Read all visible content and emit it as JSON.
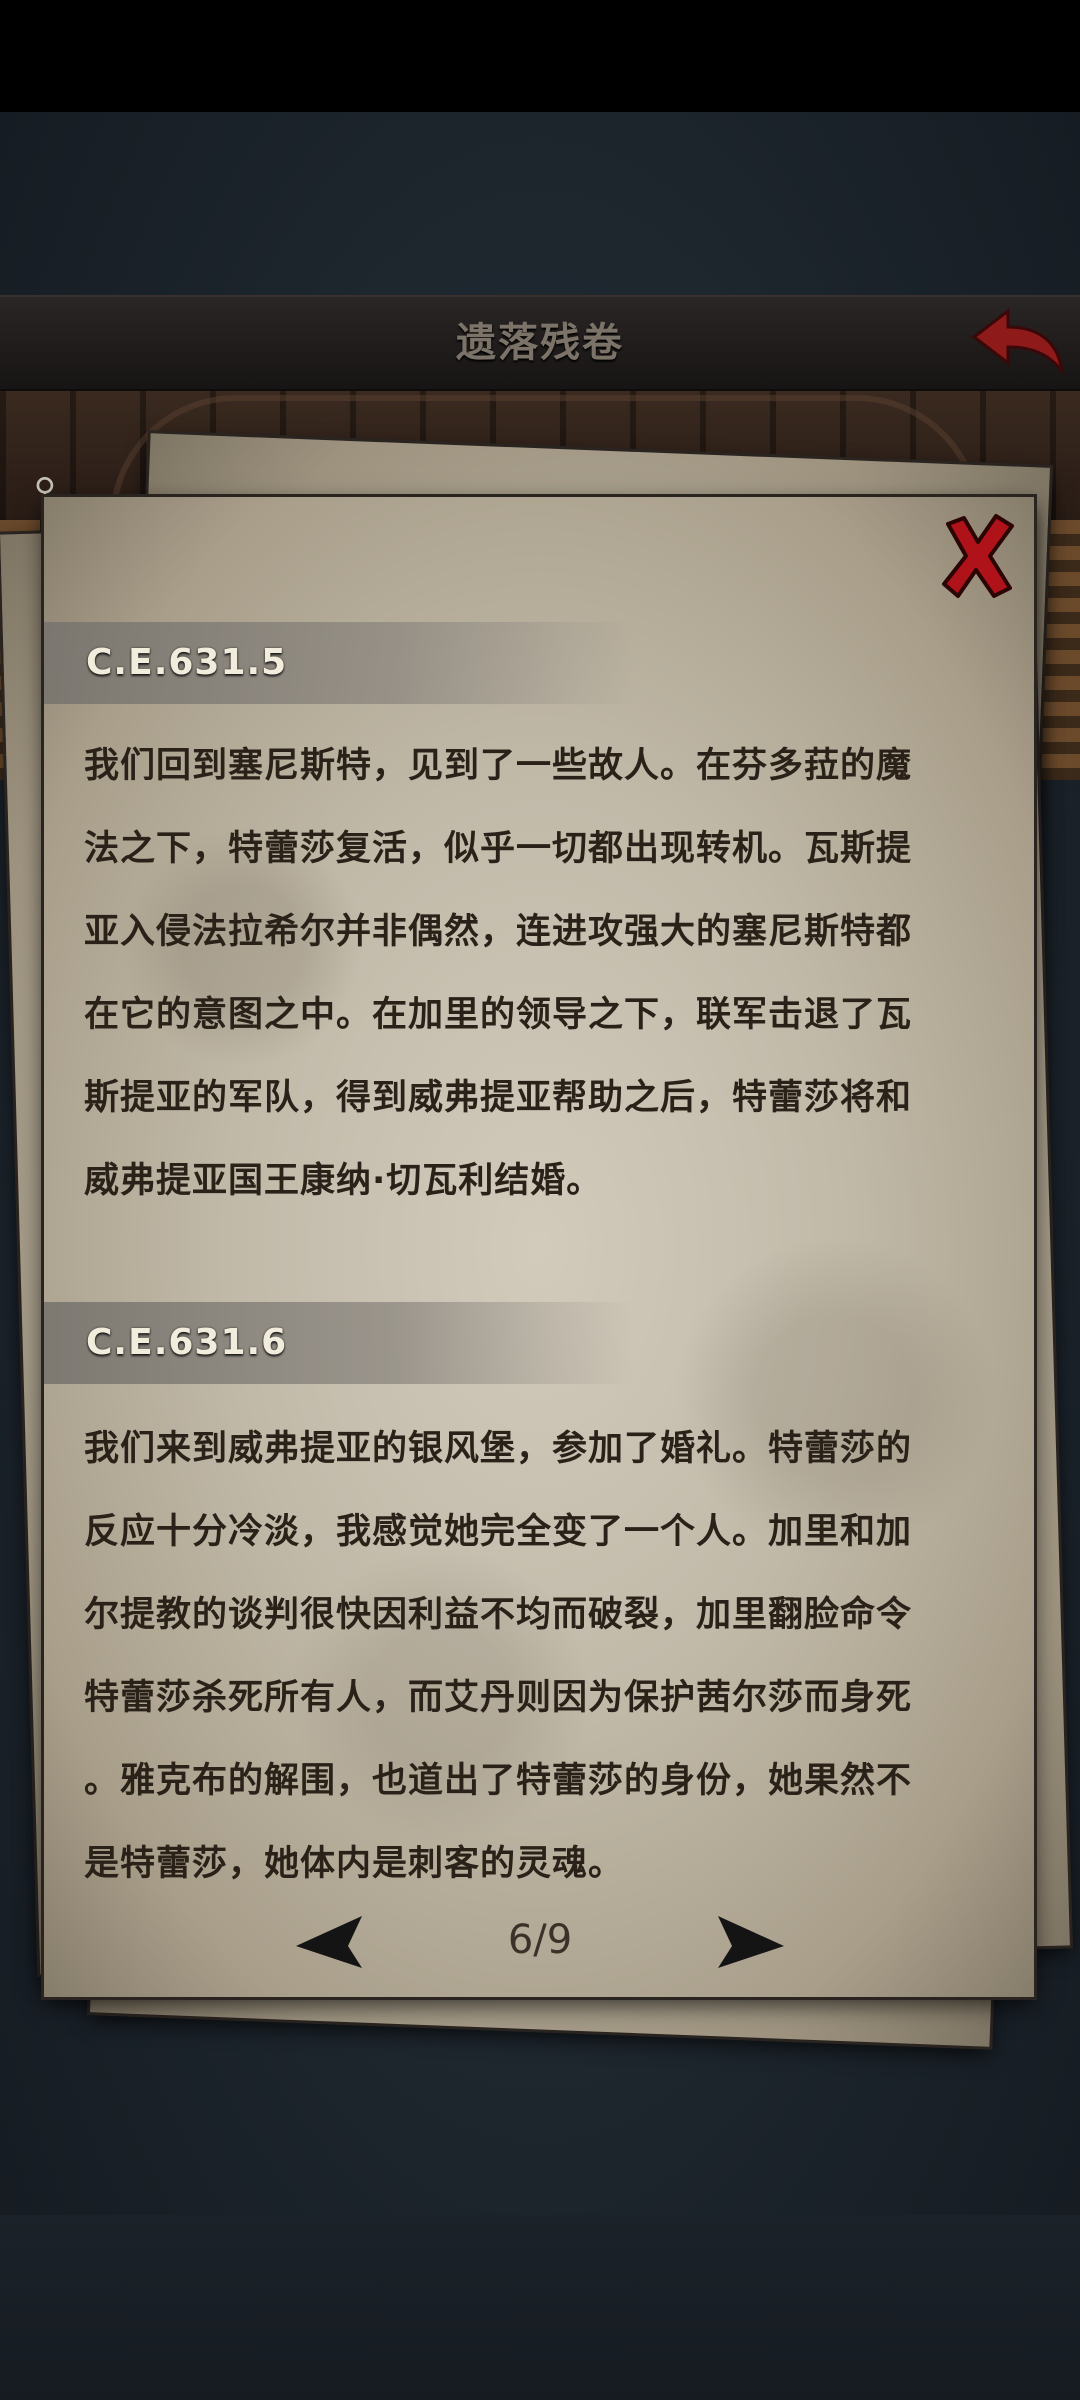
{
  "header": {
    "title": "遗落残卷"
  },
  "entries": [
    {
      "date": "C.E.631.5",
      "lines": [
        "我们回到塞尼斯特，见到了一些故人。在芬多菈的魔",
        "法之下，特蕾莎复活，似乎一切都出现转机。瓦斯提",
        "亚入侵法拉希尔并非偶然，连进攻强大的塞尼斯特都",
        "在它的意图之中。在加里的领导之下，联军击退了瓦",
        "斯提亚的军队，得到威弗提亚帮助之后，特蕾莎将和",
        "威弗提亚国王康纳·切瓦利结婚。"
      ]
    },
    {
      "date": "C.E.631.6",
      "lines": [
        "我们来到威弗提亚的银风堡，参加了婚礼。特蕾莎的",
        "反应十分冷淡，我感觉她完全变了一个人。加里和加",
        "尔提教的谈判很快因利益不均而破裂，加里翻脸命令",
        "特蕾莎杀死所有人，而艾丹则因为保护茜尔莎而身死",
        "。雅克布的解围，也道出了特蕾莎的身份，她果然不",
        "是特蕾莎，她体内是刺客的灵魂。"
      ]
    }
  ],
  "pagination": {
    "label": "6/9"
  },
  "icons": {
    "back": "back-arrow-icon",
    "close": "close-x-icon",
    "search": "search-icon",
    "prev": "prev-arrow-icon",
    "next": "next-arrow-icon"
  },
  "colors": {
    "close_red": "#b0121a",
    "back_red": "#8e1a1a",
    "text": "#2a2219",
    "parchment": "#c8c0b0"
  }
}
